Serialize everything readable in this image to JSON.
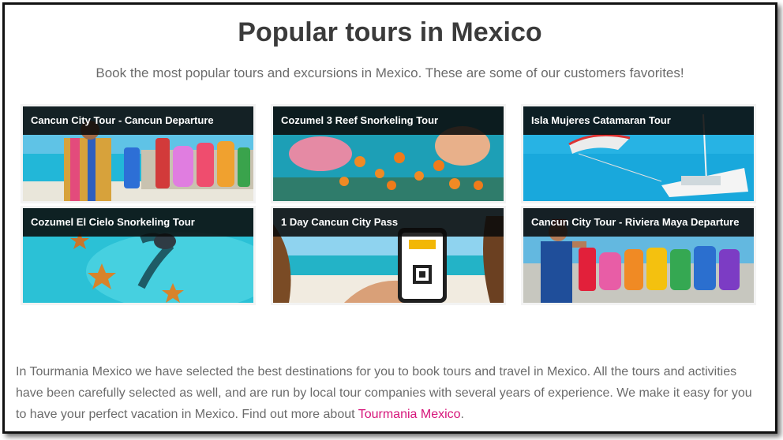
{
  "header": {
    "title": "Popular tours in Mexico",
    "subtitle": "Book the most popular tours and excursions in Mexico. These are some of our customers favorites!"
  },
  "tours": [
    {
      "label": "Cancun City Tour - Cancun Departure",
      "image": "cancun-sign-photo"
    },
    {
      "label": "Cozumel 3 Reef Snorkeling Tour",
      "image": "reef-snorkeling-photo"
    },
    {
      "label": "Isla Mujeres Catamaran Tour",
      "image": "catamaran-photo"
    },
    {
      "label": "Cozumel El Cielo Snorkeling Tour",
      "image": "starfish-snorkel-photo"
    },
    {
      "label": "1 Day Cancun City Pass",
      "image": "phone-pass-photo"
    },
    {
      "label": "Cancun City Tour - Riviera Maya Departure",
      "image": "cancun-sign-tourist-photo"
    }
  ],
  "intro": {
    "text": "In Tourmania Mexico we have selected the best destinations for you to book tours and travel in Mexico. All the tours and activities have been carefully selected as well, and are run by local tour companies with several years of experience. We make it easy for you to have your perfect vacation in Mexico. Find out more about ",
    "link_text": "Tourmania Mexico",
    "trailing": "."
  },
  "colors": {
    "link": "#d6157a",
    "title": "#3b3b3b",
    "caption_bg": "#0a0a0a"
  }
}
